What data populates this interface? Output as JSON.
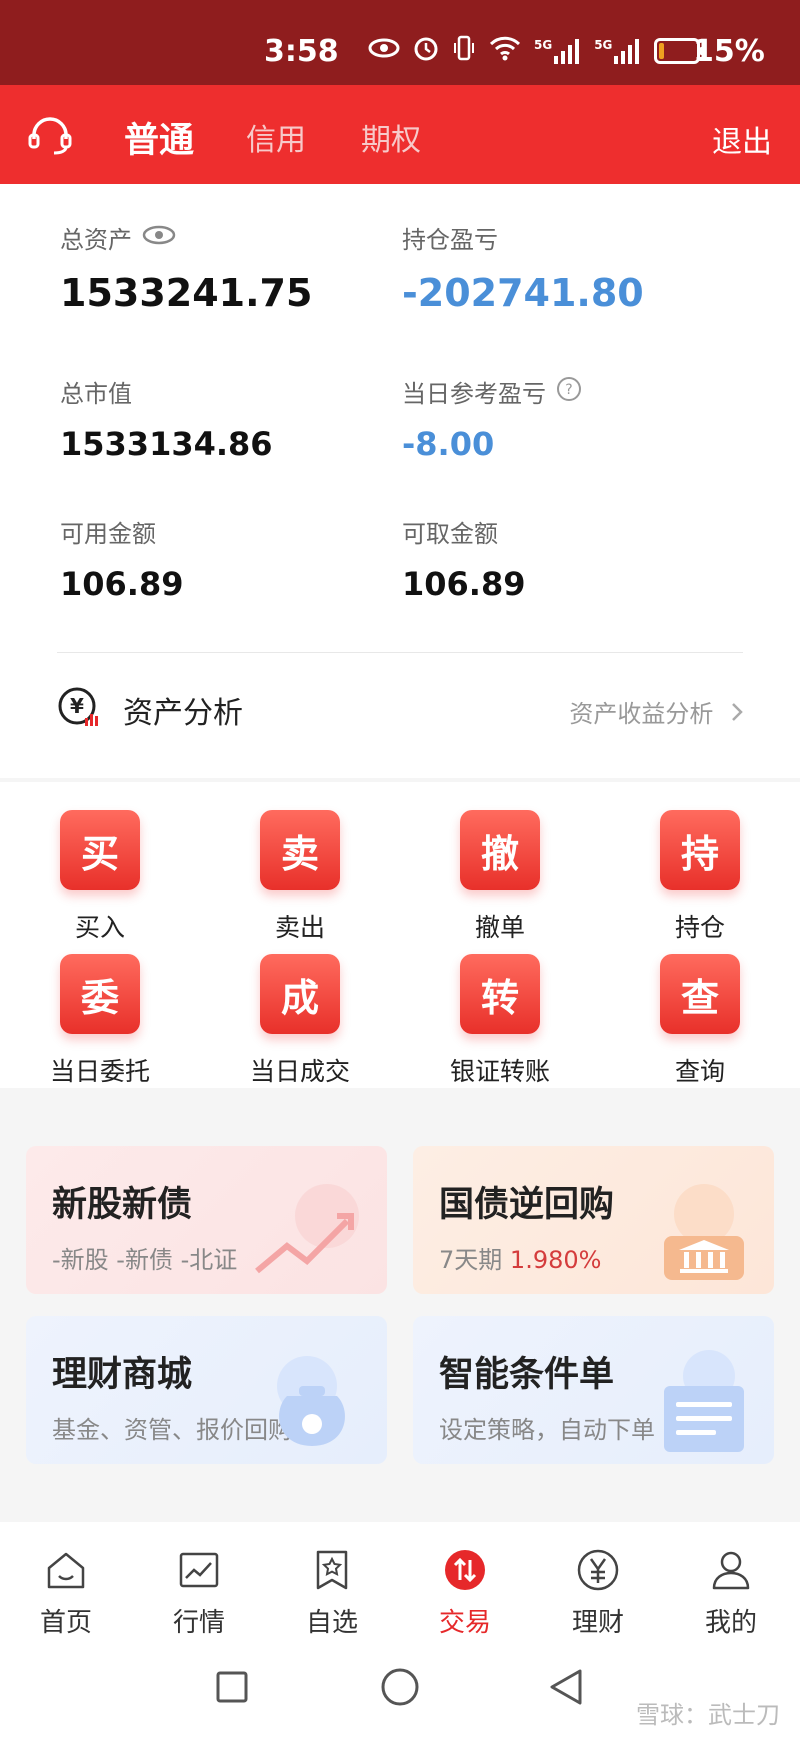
{
  "status_bar": {
    "time": "3:58",
    "network_5g_1": "5G",
    "network_5g_2": "5G",
    "battery_level": 0.15,
    "battery_pct": "15%"
  },
  "header": {
    "tabs": [
      {
        "label": "普通",
        "active": true
      },
      {
        "label": "信用",
        "active": false
      },
      {
        "label": "期权",
        "active": false
      }
    ],
    "logout": "退出"
  },
  "assets": {
    "total_assets_label": "总资产",
    "total_assets_value": "1533241.75",
    "position_pnl_label": "持仓盈亏",
    "position_pnl_value": "-202741.80",
    "market_value_label": "总市值",
    "market_value_value": "1533134.86",
    "daily_pnl_label": "当日参考盈亏",
    "daily_pnl_value": "-8.00",
    "available_label": "可用金额",
    "available_value": "106.89",
    "withdrawable_label": "可取金额",
    "withdrawable_value": "106.89",
    "analysis_title": "资产分析",
    "analysis_link": "资产收益分析"
  },
  "functions": [
    {
      "icon_char": "买",
      "label": "买入"
    },
    {
      "icon_char": "卖",
      "label": "卖出"
    },
    {
      "icon_char": "撤",
      "label": "撤单"
    },
    {
      "icon_char": "持",
      "label": "持仓"
    },
    {
      "icon_char": "委",
      "label": "当日委托"
    },
    {
      "icon_char": "成",
      "label": "当日成交"
    },
    {
      "icon_char": "转",
      "label": "银证转账"
    },
    {
      "icon_char": "查",
      "label": "查询"
    }
  ],
  "cards": {
    "new_shares": {
      "title": "新股新债",
      "subtitle": "-新股 -新债 -北证"
    },
    "repo": {
      "title": "国债逆回购",
      "subtitle_prefix": "7天期",
      "rate": "1.980%"
    },
    "wealth_mall": {
      "title": "理财商城",
      "subtitle": "基金、资管、报价回购等"
    },
    "smart_order": {
      "title": "智能条件单",
      "subtitle": "设定策略，自动下单"
    }
  },
  "bottom_nav": [
    {
      "label": "首页",
      "icon": "home-icon"
    },
    {
      "label": "行情",
      "icon": "chart-icon"
    },
    {
      "label": "自选",
      "icon": "star-icon"
    },
    {
      "label": "交易",
      "icon": "trade-icon",
      "active": true
    },
    {
      "label": "理财",
      "icon": "yen-icon"
    },
    {
      "label": "我的",
      "icon": "user-icon"
    }
  ],
  "watermark": "雪球：武士刀",
  "colors": {
    "status_bar": "#8f1d1e",
    "brand_red": "#ee2e2e",
    "loss_blue": "#4a8fd8",
    "active_nav": "#e6282a"
  }
}
